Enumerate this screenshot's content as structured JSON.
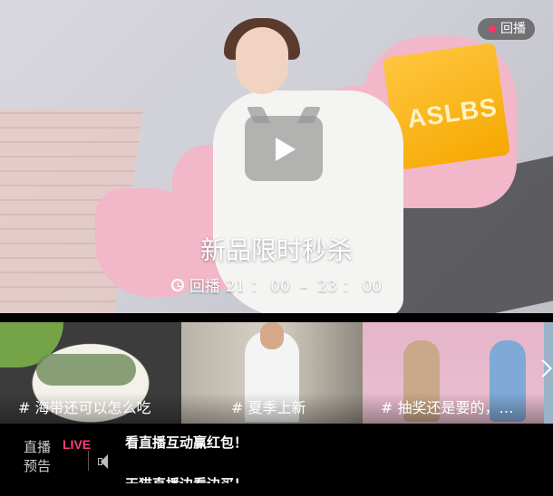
{
  "hero": {
    "badge_label": "回播",
    "title": "新品限时秒杀",
    "time_prefix": "回播",
    "time_range": "21 ： 00  –  23 ： 00",
    "bag_text": "ASLBS"
  },
  "thumbnails": [
    {
      "caption": "# 海带还可以怎么吃"
    },
    {
      "caption": "# 夏季上新"
    },
    {
      "caption": "# 抽奖还是要的，…"
    }
  ],
  "bottom": {
    "preview_line1": "直播",
    "preview_line2": "预告",
    "live_logo": "LIVE",
    "message_1": "看直播互动赢红包！",
    "message_2": "天猫直播边看边买！"
  },
  "colors": {
    "accent": "#ff3b7c",
    "badge_dot": "#ff3366"
  },
  "icons": [
    "play-icon",
    "clock-icon",
    "chevron-right-icon",
    "speaker-icon"
  ]
}
